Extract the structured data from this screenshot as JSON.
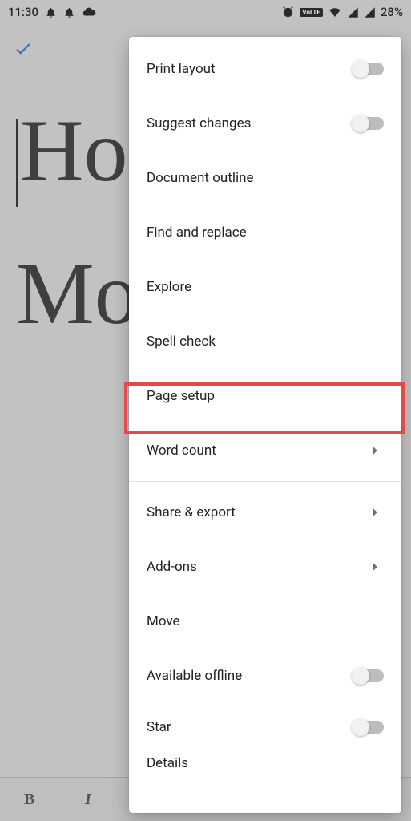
{
  "status": {
    "time": "11:30",
    "battery": "28%",
    "volte": "VoLTE"
  },
  "document": {
    "line1": "Ho",
    "line2": "Mo"
  },
  "menu": {
    "print_layout": "Print layout",
    "suggest_changes": "Suggest changes",
    "document_outline": "Document outline",
    "find_replace": "Find and replace",
    "explore": "Explore",
    "spell_check": "Spell check",
    "page_setup": "Page setup",
    "word_count": "Word count",
    "share_export": "Share & export",
    "add_ons": "Add-ons",
    "move": "Move",
    "available_offline": "Available offline",
    "star": "Star",
    "details": "Details"
  },
  "toolbar": {
    "bold": "B",
    "italic": "I"
  }
}
